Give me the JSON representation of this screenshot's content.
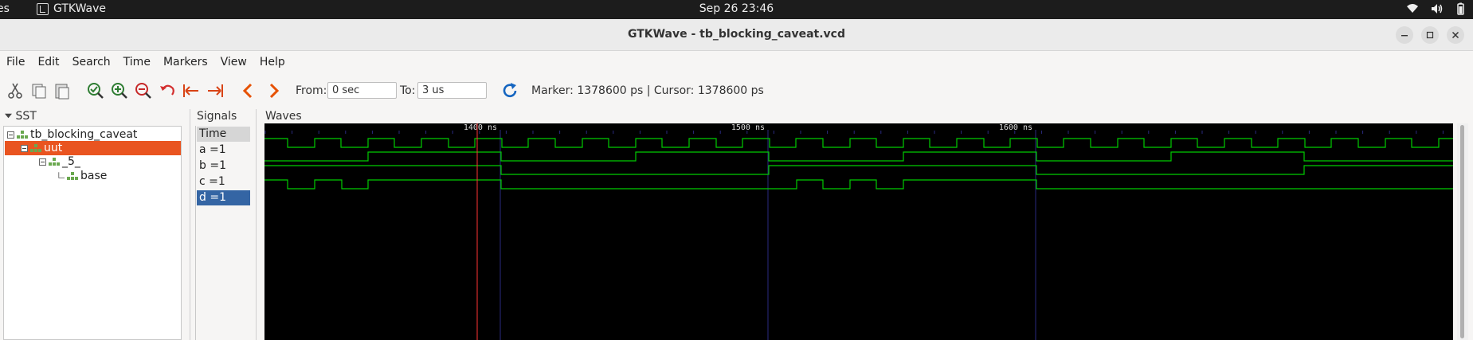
{
  "topbar": {
    "activities": "es",
    "app_name": "GTKWave",
    "clock": "Sep 26  23:46",
    "tray_icons": [
      "wifi-icon",
      "volume-icon",
      "battery-icon"
    ]
  },
  "window": {
    "title": "GTKWave - tb_blocking_caveat.vcd",
    "controls": [
      "minimize-icon",
      "maximize-icon",
      "close-icon"
    ]
  },
  "menu": [
    "File",
    "Edit",
    "Search",
    "Time",
    "Markers",
    "View",
    "Help"
  ],
  "toolbar": {
    "icons": [
      "cut-icon",
      "copy-icon",
      "paste-icon",
      "zoom-fit-icon",
      "zoom-in-icon",
      "zoom-out-icon",
      "undo-icon",
      "goto-start-icon",
      "goto-end-icon",
      "prev-edge-icon",
      "next-edge-icon",
      "reload-icon"
    ],
    "from_label": "From:",
    "from_value": "0 sec",
    "to_label": "To:",
    "to_value": "3 us",
    "status": "Marker: 1378600 ps  |  Cursor: 1378600 ps"
  },
  "sst": {
    "header": "SST",
    "tree": [
      {
        "label": "tb_blocking_caveat",
        "level": 0,
        "selected": false
      },
      {
        "label": "uut",
        "level": 1,
        "selected": true
      },
      {
        "label": "_5_",
        "level": 2,
        "selected": false
      },
      {
        "label": "base",
        "level": 3,
        "selected": false
      }
    ]
  },
  "signals": {
    "header": "Signals",
    "rows": [
      "Time",
      "a =1",
      "b =1",
      "c =1",
      "d =1"
    ],
    "selected_index": 4
  },
  "waves": {
    "header": "Waves",
    "time_labels": [
      "1400 ns",
      "1500 ns",
      "1600 ns"
    ],
    "colors": {
      "background": "#000000",
      "trace": "#00cc00",
      "grid": "#2a2a80",
      "cursor": "#ff3333"
    }
  }
}
